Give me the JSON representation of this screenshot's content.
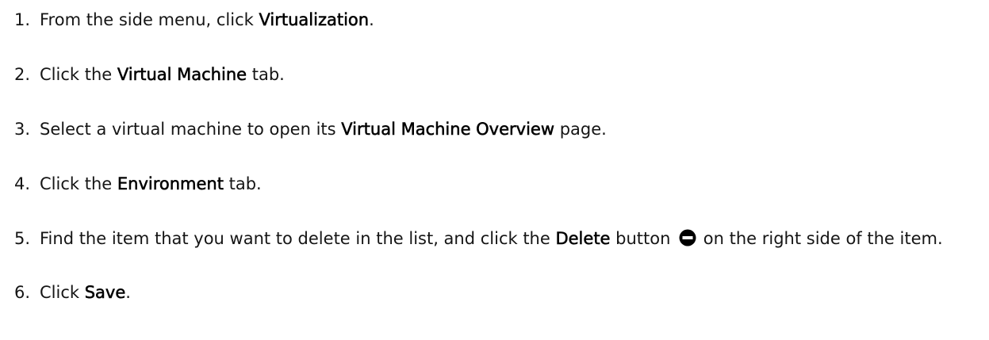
{
  "steps": [
    {
      "number": "1.",
      "text_before": "From the side menu, click ",
      "bold": "Virtualization",
      "text_after": "."
    },
    {
      "number": "2.",
      "text_before": "Click the ",
      "bold": "Virtual Machine",
      "text_after": " tab."
    },
    {
      "number": "3.",
      "text_before": "Select a virtual machine to open its ",
      "bold": "Virtual Machine Overview",
      "text_after": " page."
    },
    {
      "number": "4.",
      "text_before": "Click the ",
      "bold": "Environment",
      "text_after": " tab."
    },
    {
      "number": "5.",
      "text_before": "Find the item that you want to delete in the list, and click the ",
      "bold": "Delete",
      "text_middle": " button ",
      "icon": "minus-circle-icon",
      "text_after": " on the right side of the item."
    },
    {
      "number": "6.",
      "text_before": "Click ",
      "bold": "Save",
      "text_after": "."
    }
  ]
}
